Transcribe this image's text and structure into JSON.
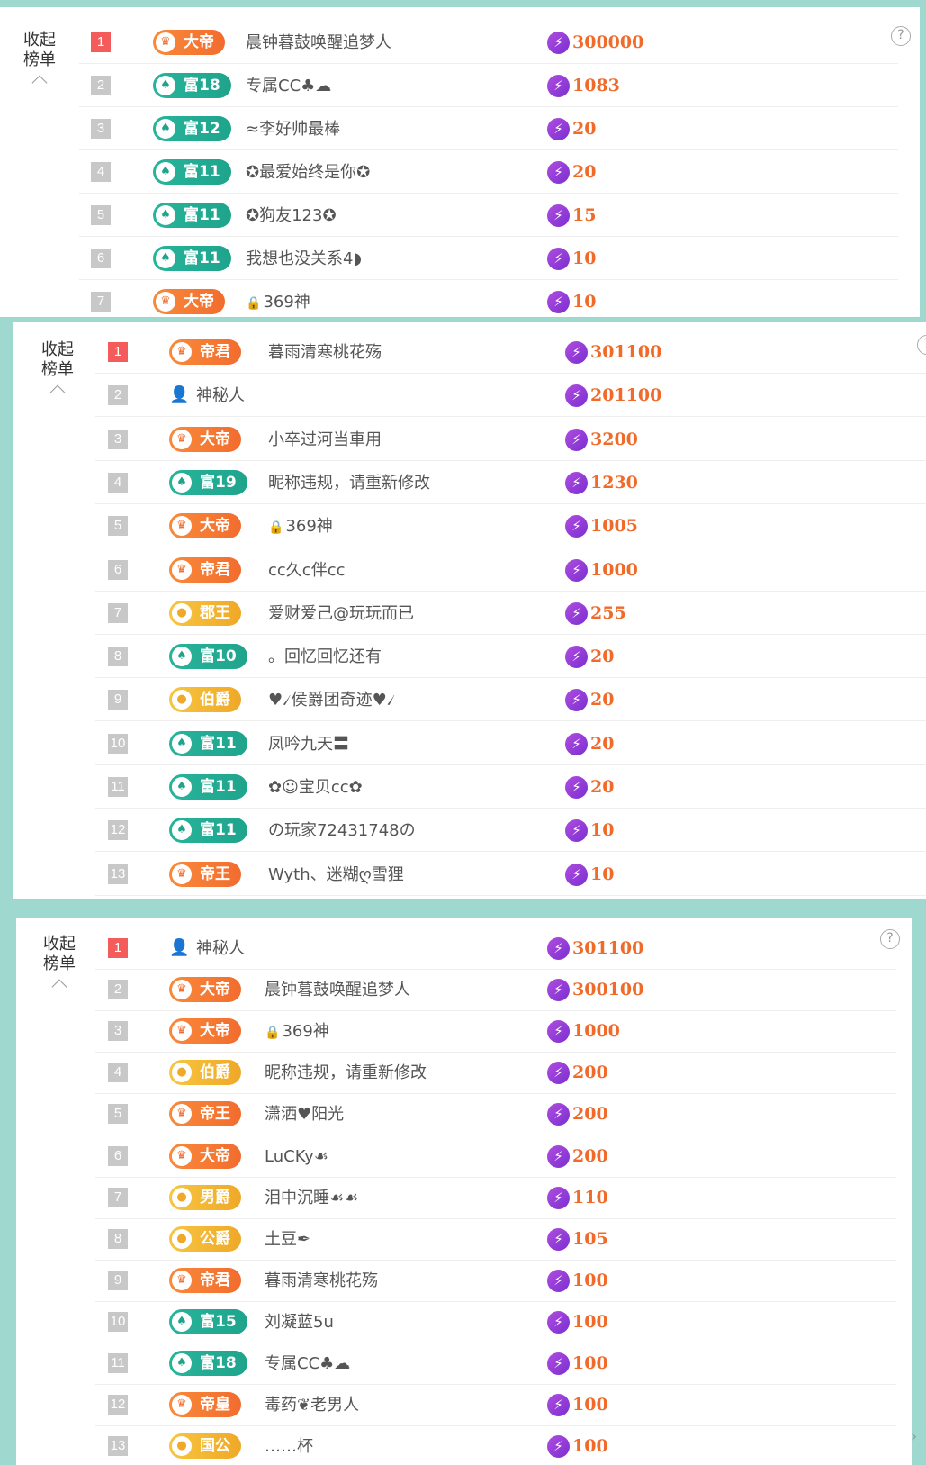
{
  "panels": [
    {
      "collapse_line1": "收起",
      "collapse_line2": "榜单",
      "help_glyph": "?",
      "rows": [
        {
          "rank": "1",
          "badge_text": "大帝",
          "badge_icon": "crown-icon",
          "badge_color": "orange",
          "name": "晨钟暮鼓唤醒追梦人",
          "score": "300000"
        },
        {
          "rank": "2",
          "badge_text": "富18",
          "badge_icon": "leaf-icon",
          "badge_color": "green",
          "name": "专属CC♣☁",
          "score": "1083"
        },
        {
          "rank": "3",
          "badge_text": "富12",
          "badge_icon": "leaf-icon",
          "badge_color": "green",
          "name": "≈李好帅最棒",
          "score": "20"
        },
        {
          "rank": "4",
          "badge_text": "富11",
          "badge_icon": "leaf-icon",
          "badge_color": "green",
          "name": "✪最爱始终是你✪",
          "score": "20"
        },
        {
          "rank": "5",
          "badge_text": "富11",
          "badge_icon": "leaf-icon",
          "badge_color": "green",
          "name": "✪狗友123✪",
          "score": "15"
        },
        {
          "rank": "6",
          "badge_text": "富11",
          "badge_icon": "leaf-icon",
          "badge_color": "green",
          "name": "我想也没关系4◗",
          "score": "10"
        },
        {
          "rank": "7",
          "badge_text": "大帝",
          "badge_icon": "crown-icon",
          "badge_color": "orange",
          "name": "369神",
          "name_prefix_icon": "lock-icon",
          "score": "10"
        }
      ]
    },
    {
      "collapse_line1": "收起",
      "collapse_line2": "榜单",
      "help_glyph": "?",
      "rows": [
        {
          "rank": "1",
          "badge_text": "帝君",
          "badge_icon": "crown-icon",
          "badge_color": "orange",
          "name": "暮雨清寒桃花殇",
          "score": "301100"
        },
        {
          "rank": "2",
          "badge_text": "",
          "badge_icon": "",
          "badge_color": "",
          "avatar": "mystery-user-icon",
          "name": "神秘人",
          "score": "201100"
        },
        {
          "rank": "3",
          "badge_text": "大帝",
          "badge_icon": "crown-icon",
          "badge_color": "orange",
          "name": "小卒过河当車用",
          "score": "3200"
        },
        {
          "rank": "4",
          "badge_text": "富19",
          "badge_icon": "leaf-icon",
          "badge_color": "green",
          "name": "昵称违规，请重新修改",
          "score": "1230"
        },
        {
          "rank": "5",
          "badge_text": "大帝",
          "badge_icon": "crown-icon",
          "badge_color": "orange",
          "name": "369神",
          "name_prefix_icon": "lock-icon",
          "score": "1005"
        },
        {
          "rank": "6",
          "badge_text": "帝君",
          "badge_icon": "crown-icon",
          "badge_color": "orange",
          "name": "ⅽⅽ久ⅽ伴ⅽⅽ",
          "score": "1000"
        },
        {
          "rank": "7",
          "badge_text": "郡王",
          "badge_icon": "sun-icon",
          "badge_color": "gold",
          "name": "爱财爱己@玩玩而已",
          "score": "255"
        },
        {
          "rank": "8",
          "badge_text": "富10",
          "badge_icon": "leaf-icon",
          "badge_color": "green",
          "name": "。回忆回忆还有",
          "score": "20"
        },
        {
          "rank": "9",
          "badge_text": "伯爵",
          "badge_icon": "sun-icon",
          "badge_color": "gold",
          "name": "♥৴侯爵团奇迹♥৴",
          "score": "20"
        },
        {
          "rank": "10",
          "badge_text": "富11",
          "badge_icon": "leaf-icon",
          "badge_color": "green",
          "name": "凤吟九天〓",
          "score": "20"
        },
        {
          "rank": "11",
          "badge_text": "富11",
          "badge_icon": "leaf-icon",
          "badge_color": "green",
          "name": "✿☺宝贝ⅽⅽ✿",
          "score": "20"
        },
        {
          "rank": "12",
          "badge_text": "富11",
          "badge_icon": "leaf-icon",
          "badge_color": "green",
          "name": "の玩家72431748の",
          "score": "10"
        },
        {
          "rank": "13",
          "badge_text": "帝王",
          "badge_icon": "crown-icon",
          "badge_color": "orange",
          "name": "Wyth、迷糊ღ雪狸",
          "score": "10"
        }
      ]
    },
    {
      "collapse_line1": "收起",
      "collapse_line2": "榜单",
      "help_glyph": "?",
      "rows": [
        {
          "rank": "1",
          "badge_text": "",
          "badge_icon": "",
          "badge_color": "",
          "avatar": "mystery-user-icon",
          "name": "神秘人",
          "score": "301100"
        },
        {
          "rank": "2",
          "badge_text": "大帝",
          "badge_icon": "crown-icon",
          "badge_color": "orange",
          "name": "晨钟暮鼓唤醒追梦人",
          "score": "300100"
        },
        {
          "rank": "3",
          "badge_text": "大帝",
          "badge_icon": "crown-icon",
          "badge_color": "orange",
          "name": "369神",
          "name_prefix_icon": "lock-icon",
          "score": "1000"
        },
        {
          "rank": "4",
          "badge_text": "伯爵",
          "badge_icon": "sun-icon",
          "badge_color": "gold",
          "name": "昵称违规，请重新修改",
          "score": "200"
        },
        {
          "rank": "5",
          "badge_text": "帝王",
          "badge_icon": "crown-icon",
          "badge_color": "orange",
          "name": "潇洒♥阳光",
          "score": "200"
        },
        {
          "rank": "6",
          "badge_text": "大帝",
          "badge_icon": "crown-icon",
          "badge_color": "orange",
          "name": "LuCKy☙",
          "score": "200"
        },
        {
          "rank": "7",
          "badge_text": "男爵",
          "badge_icon": "sun-icon",
          "badge_color": "gold",
          "name": "泪中沉睡☙☙",
          "score": "110"
        },
        {
          "rank": "8",
          "badge_text": "公爵",
          "badge_icon": "sun-icon",
          "badge_color": "gold",
          "name": "土豆✒",
          "score": "105"
        },
        {
          "rank": "9",
          "badge_text": "帝君",
          "badge_icon": "crown-icon",
          "badge_color": "orange",
          "name": "暮雨清寒桃花殇",
          "score": "100"
        },
        {
          "rank": "10",
          "badge_text": "富15",
          "badge_icon": "leaf-icon",
          "badge_color": "green",
          "name": "刘凝蓝5u",
          "score": "100"
        },
        {
          "rank": "11",
          "badge_text": "富18",
          "badge_icon": "leaf-icon",
          "badge_color": "green",
          "name": "专属CC♣☁",
          "score": "100"
        },
        {
          "rank": "12",
          "badge_text": "帝皇",
          "badge_icon": "crown-icon",
          "badge_color": "orange",
          "name": "毒药❦老男人",
          "score": "100"
        },
        {
          "rank": "13",
          "badge_text": "国公",
          "badge_icon": "sun-icon",
          "badge_color": "gold",
          "name": "……杯",
          "score": "100"
        }
      ]
    }
  ],
  "colors": {
    "background": "#9fd8cf",
    "rank_top": "#f45c5c",
    "rank_other": "#c8c8c8",
    "score": "#f06a2a",
    "score_icon": "#8a3ad6"
  },
  "icons": {
    "score_icon": "lightning-icon",
    "collapse_caret": "chevron-up-icon",
    "help": "question-circle-icon",
    "side_nav": "chevron-right-icon"
  }
}
